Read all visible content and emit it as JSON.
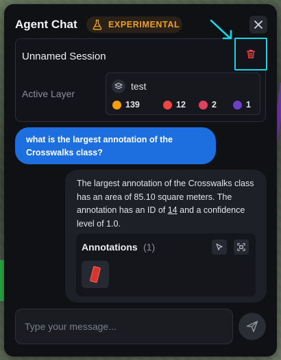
{
  "header": {
    "title": "Agent Chat",
    "badge": "EXPERIMENTAL",
    "badge_icon": "flask-icon",
    "close_icon": "close-icon"
  },
  "session": {
    "name": "Unnamed Session",
    "delete_icon": "trash-icon",
    "active_layer_label": "Active Layer",
    "layer": {
      "icon": "layers-icon",
      "name": "test",
      "counts": [
        {
          "value": "139",
          "color": "#f59e0b"
        },
        {
          "value": "12",
          "color": "#ef4444"
        },
        {
          "value": "2",
          "color": "#e0415c"
        },
        {
          "value": "1",
          "color": "#6d3fc7"
        }
      ]
    }
  },
  "messages": {
    "user": "what is the largest annotation of the Crosswalks class?",
    "assistant": {
      "text_before_id": "The largest annotation of the Crosswalks class has an area of 85.10 square meters. The annotation has an ID of ",
      "id": "14",
      "text_after_id": " and a confidence level of 1.0.",
      "annotations_title": "Annotations",
      "annotations_count": "(1)",
      "select_icon": "cursor-icon",
      "focus_icon": "focus-frame-icon",
      "thumbnail_color": "#d6342e"
    }
  },
  "composer": {
    "placeholder": "Type your message...",
    "send_icon": "send-icon"
  },
  "colors": {
    "accent": "#1d6fe0",
    "badge": "#f0a020",
    "highlight": "#17d6e6"
  }
}
